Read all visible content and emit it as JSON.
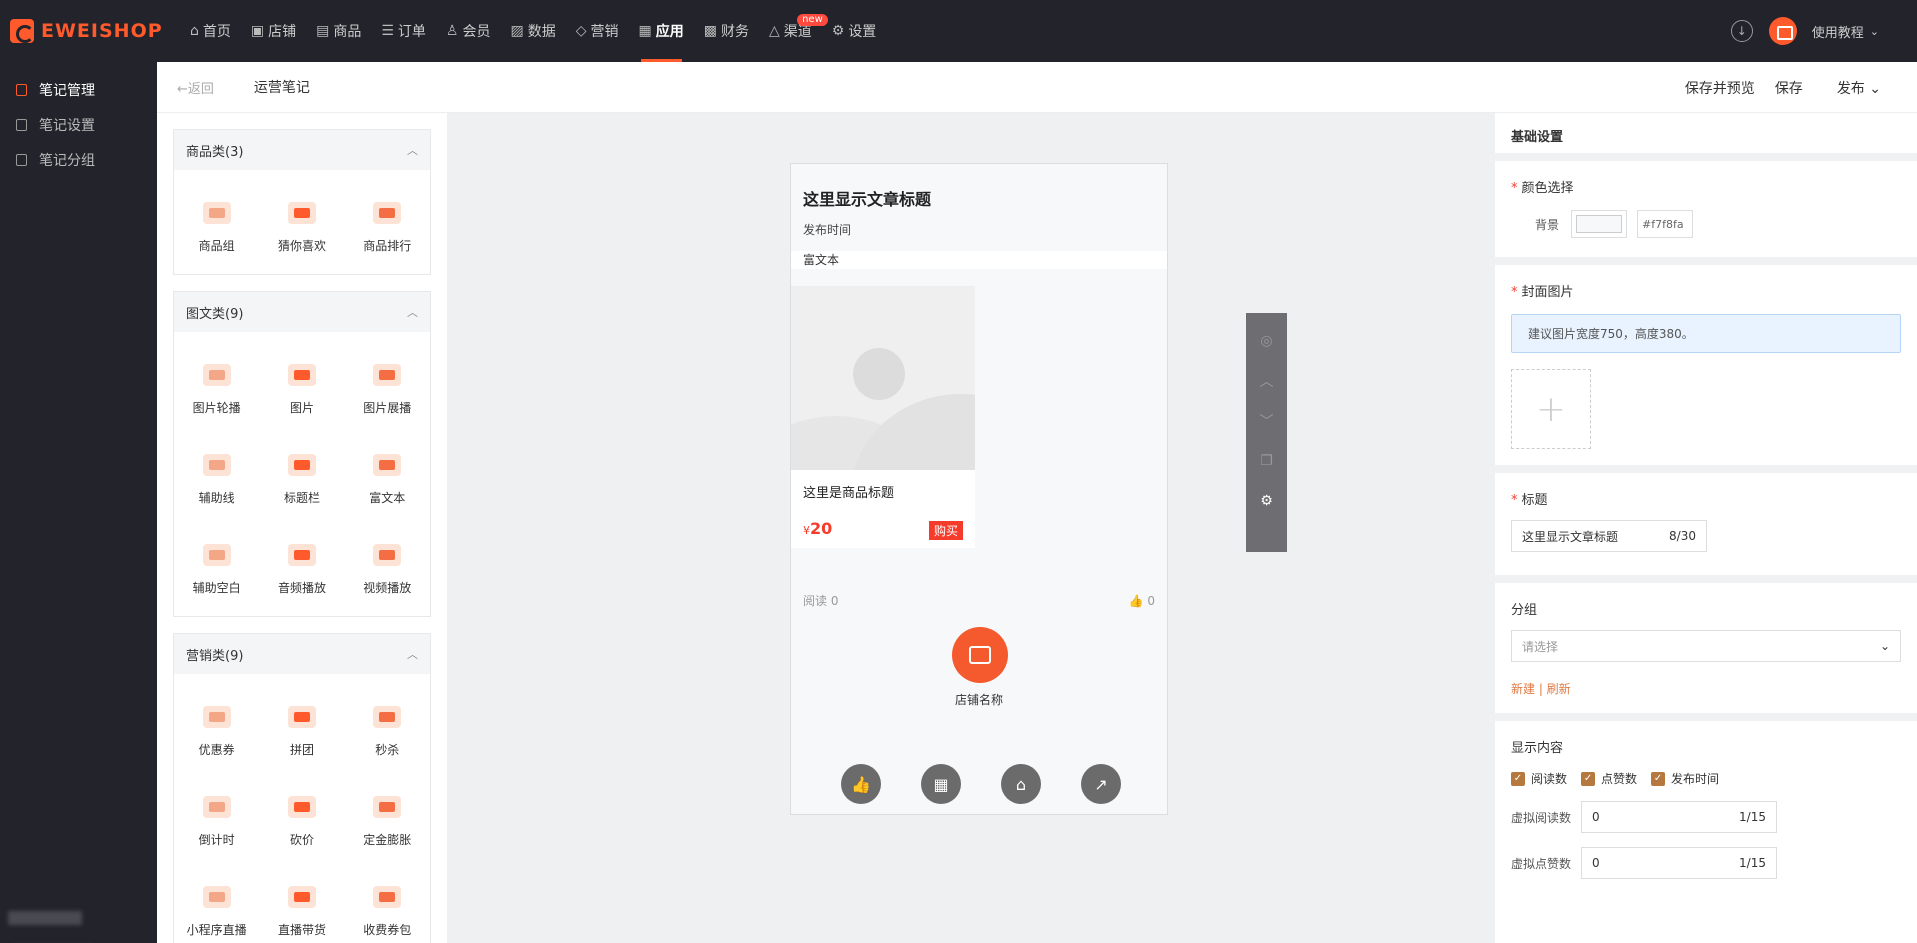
{
  "brand": {
    "name": "EWEISHOP",
    "color": "#ff5a2c"
  },
  "topnav": {
    "items": [
      {
        "label": "首页",
        "icon": "home-icon"
      },
      {
        "label": "店铺",
        "icon": "store-icon"
      },
      {
        "label": "商品",
        "icon": "goods-icon"
      },
      {
        "label": "订单",
        "icon": "order-icon"
      },
      {
        "label": "会员",
        "icon": "member-icon"
      },
      {
        "label": "数据",
        "icon": "chart-icon"
      },
      {
        "label": "营销",
        "icon": "tag-icon"
      },
      {
        "label": "应用",
        "icon": "app-icon",
        "active": true
      },
      {
        "label": "财务",
        "icon": "finance-icon"
      },
      {
        "label": "渠道",
        "icon": "channel-icon",
        "badge": "new"
      },
      {
        "label": "设置",
        "icon": "gear-icon"
      }
    ],
    "help_label": "使用教程"
  },
  "sidebar": {
    "items": [
      {
        "label": "笔记管理",
        "active": true
      },
      {
        "label": "笔记设置"
      },
      {
        "label": "笔记分组"
      }
    ]
  },
  "header": {
    "back_label": "←返回",
    "page_title": "运营笔记",
    "save_preview": "保存并预览",
    "save": "保存",
    "publish": "发布 ⌄"
  },
  "components": {
    "groups": [
      {
        "title": "商品类(3)",
        "items": [
          "商品组",
          "猜你喜欢",
          "商品排行"
        ]
      },
      {
        "title": "图文类(9)",
        "items": [
          "图片轮播",
          "图片",
          "图片展播",
          "辅助线",
          "标题栏",
          "富文本",
          "辅助空白",
          "音频播放",
          "视频播放"
        ]
      },
      {
        "title": "营销类(9)",
        "items": [
          "优惠券",
          "拼团",
          "秒杀",
          "倒计时",
          "砍价",
          "定金膨胀",
          "小程序直播",
          "直播带货",
          "收费券包"
        ]
      }
    ]
  },
  "preview": {
    "article_title": "这里显示文章标题",
    "publish_time": "发布时间",
    "richtext": "富文本",
    "product_title": "这里是商品标题",
    "price_symbol": "¥",
    "price": "20",
    "buy_label": "购买",
    "read_label": "阅读 0",
    "like_count": "0",
    "shop_name": "店铺名称"
  },
  "settings": {
    "section_title": "基础设置",
    "color_label": "颜色选择",
    "bg_label": "背景",
    "bg_value": "#f7f8fa",
    "cover_label": "封面图片",
    "cover_tip": "建议图片宽度750，高度380。",
    "title_label": "标题",
    "title_value": "这里显示文章标题",
    "title_count": "8/30",
    "group_label": "分组",
    "group_placeholder": "请选择",
    "group_links": "新建 | 刷新",
    "display_label": "显示内容",
    "checks": [
      "阅读数",
      "点赞数",
      "发布时间"
    ],
    "virtual_read_label": "虚拟阅读数",
    "virtual_read_value": "0",
    "virtual_read_count": "1/15",
    "virtual_like_label": "虚拟点赞数",
    "virtual_like_value": "0",
    "virtual_like_count": "1/15"
  }
}
